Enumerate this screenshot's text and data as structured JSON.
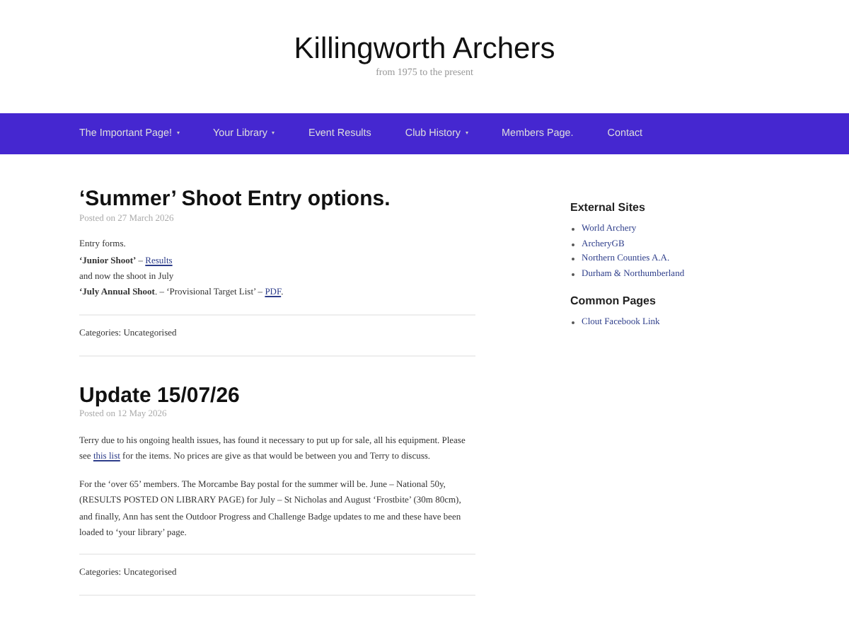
{
  "site": {
    "title": "Killingworth Archers",
    "tagline": "from 1975 to the present"
  },
  "nav": [
    {
      "label": "The Important Page!",
      "dropdown": true
    },
    {
      "label": "Your Library",
      "dropdown": true
    },
    {
      "label": "Event Results",
      "dropdown": false
    },
    {
      "label": "Club History",
      "dropdown": true
    },
    {
      "label": "Members Page.",
      "dropdown": false
    },
    {
      "label": "Contact",
      "dropdown": false
    }
  ],
  "posts": [
    {
      "title": "‘Summer’ Shoot Entry options.",
      "posted": "Posted on 27 March 2026",
      "paragraphs": [
        [
          [
            {
              "kind": "text",
              "text": "Entry forms."
            }
          ],
          [
            {
              "kind": "bold",
              "text": "‘Junior Shoot’"
            },
            {
              "kind": "text",
              "text": " – "
            },
            {
              "kind": "link",
              "text": "Results"
            }
          ],
          [
            {
              "kind": "text",
              "text": "and now the shoot in July"
            }
          ],
          [
            {
              "kind": "bold",
              "text": "‘July Annual Shoot"
            },
            {
              "kind": "text",
              "text": ". – ‘Provisional Target List’ – "
            },
            {
              "kind": "link",
              "text": "PDF"
            },
            {
              "kind": "text",
              "text": "."
            }
          ]
        ]
      ],
      "categories": "Categories: Uncategorised"
    },
    {
      "title": "Update 15/07/26",
      "posted": "Posted on 12 May 2026",
      "paragraphs": [
        [
          [
            {
              "kind": "text",
              "text": "Terry due to his ongoing health issues, has found it necessary to put up for sale, all his equipment. Please see "
            },
            {
              "kind": "link",
              "text": "this list"
            },
            {
              "kind": "text",
              "text": " for the items. No prices are give as that would be between you and Terry to discuss."
            }
          ]
        ],
        [
          [
            {
              "kind": "text",
              "text": "For the ‘over 65’ members. The Morcambe Bay postal for the summer will be. June – National 50y, (RESULTS POSTED ON LIBRARY PAGE) for July – St Nicholas and August ‘Frostbite’ (30m 80cm), and finally, Ann has sent the Outdoor Progress and Challenge Badge updates to me and these have been loaded to ‘your library’ page."
            }
          ]
        ]
      ],
      "categories": "Categories: Uncategorised"
    }
  ],
  "sidebar": [
    {
      "heading": "External Sites",
      "links": [
        "World Archery",
        "ArcheryGB",
        "Northern Counties A.A.",
        "Durham & Northumberland"
      ]
    },
    {
      "heading": "Common Pages",
      "links": [
        "Clout Facebook Link"
      ]
    }
  ]
}
